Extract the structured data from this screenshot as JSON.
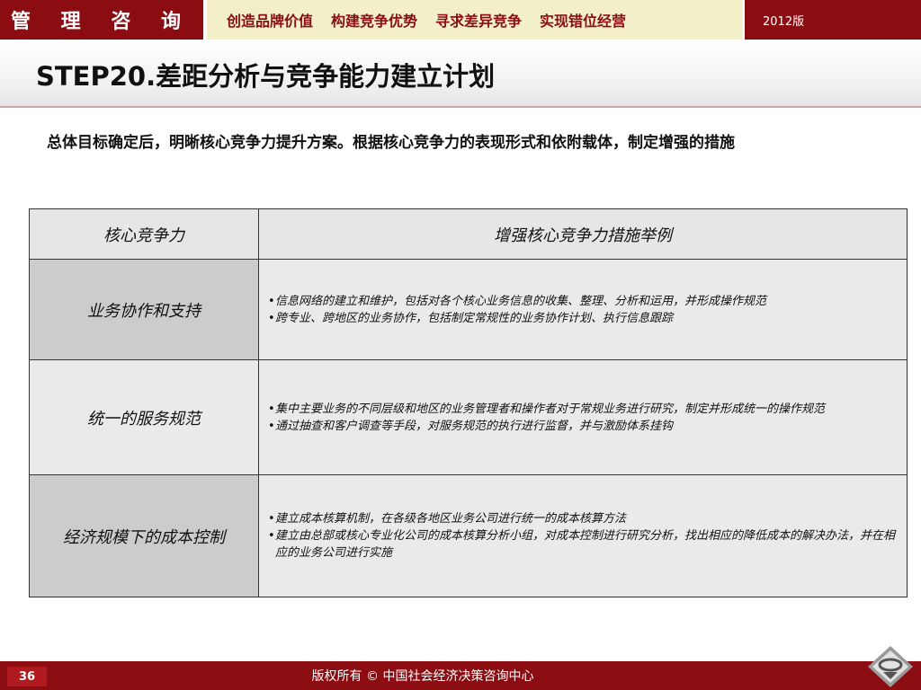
{
  "header": {
    "brand": "管 理 咨 询",
    "taglines": [
      "创造品牌价值",
      "构建竞争优势",
      "寻求差异竞争",
      "实现错位经营"
    ],
    "edition": "2012版"
  },
  "page_title": "STEP20.差距分析与竞争能力建立计划",
  "intro": "总体目标确定后，明晰核心竞争力提升方案。根据核心竞争力的表现形式和依附载体，制定增强的措施",
  "table": {
    "headers": [
      "核心竞争力",
      "增强核心竞争力措施举例"
    ],
    "rows": [
      {
        "label": "业务协作和支持",
        "bullets": [
          "信息网络的建立和维护，包括对各个核心业务信息的收集、整理、分析和运用，并形成操作规范",
          "跨专业、跨地区的业务协作，包括制定常规性的业务协作计划、执行信息跟踪"
        ]
      },
      {
        "label": "统一的服务规范",
        "bullets": [
          "集中主要业务的不同层级和地区的业务管理者和操作者对于常规业务进行研究，制定并形成统一的操作规范",
          "通过抽查和客户调查等手段，对服务规范的执行进行监督，并与激励体系挂钩"
        ]
      },
      {
        "label": "经济规模下的成本控制",
        "bullets": [
          "建立成本核算机制，在各级各地区业务公司进行统一的成本核算方法",
          "建立由总部或核心专业化公司的成本核算分析小组，对成本控制进行研究分析，找出相应的降低成本的解决办法，并在相应的业务公司进行实施"
        ]
      }
    ]
  },
  "footer": {
    "page_number": "36",
    "copyright": "版权所有 © 中国社会经济决策咨询中心"
  },
  "colors": {
    "brand_red": "#8b0d12",
    "tagline_bg": "#f3efc9",
    "row_dark": "#cccccc",
    "row_light": "#eaeaea"
  },
  "icons": [
    "diamond-logo-icon"
  ]
}
